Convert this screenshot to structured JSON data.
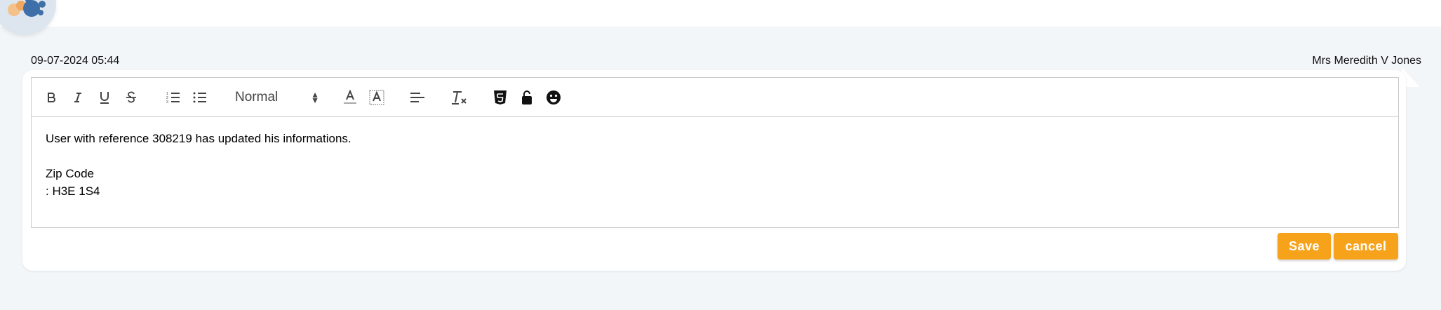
{
  "header": {
    "timestamp": "09-07-2024 05:44",
    "author": "Mrs Meredith V Jones"
  },
  "toolbar": {
    "size_select_value": "Normal",
    "buttons": [
      "bold-icon",
      "italic-icon",
      "underline-icon",
      "strikethrough-icon",
      "ordered-list-icon",
      "bullet-list-icon",
      "text-color-icon",
      "background-color-icon",
      "align-icon",
      "clear-format-icon",
      "html5-icon",
      "lock-icon",
      "emoji-icon"
    ]
  },
  "editor": {
    "lines": [
      "User with reference 308219 has updated his informations.",
      "",
      "Zip Code",
      ": H3E 1S4"
    ]
  },
  "actions": {
    "save_label": "Save",
    "cancel_label": "cancel"
  },
  "colors": {
    "accent": "#f7a21b",
    "background": "#f2f6f8"
  }
}
